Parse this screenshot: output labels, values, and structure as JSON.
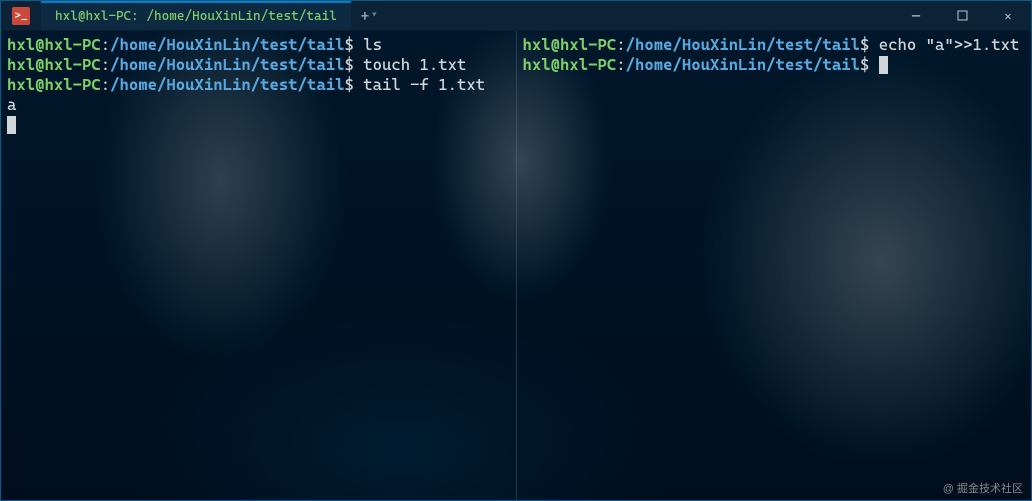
{
  "titlebar": {
    "tab_title": "hxl@hxl-PC: /home/HouXinLin/test/tail",
    "plus": "+",
    "minimize": "─",
    "maximize": "☐",
    "close": "✕"
  },
  "prompt": {
    "user": "hxl@hxl-PC",
    "colon": ":",
    "path": "/home/HouXinLin/test/tail",
    "symbol": "$"
  },
  "left_pane": {
    "lines": [
      {
        "cmd": "ls"
      },
      {
        "cmd": "touch 1.txt"
      },
      {
        "cmd": "tail -f 1.txt"
      }
    ],
    "output": "a"
  },
  "right_pane": {
    "lines": [
      {
        "cmd": "echo \"a\">>1.txt",
        "wrap": true
      },
      {
        "cmd": ""
      }
    ]
  },
  "watermark": "@ 掘金技术社区"
}
